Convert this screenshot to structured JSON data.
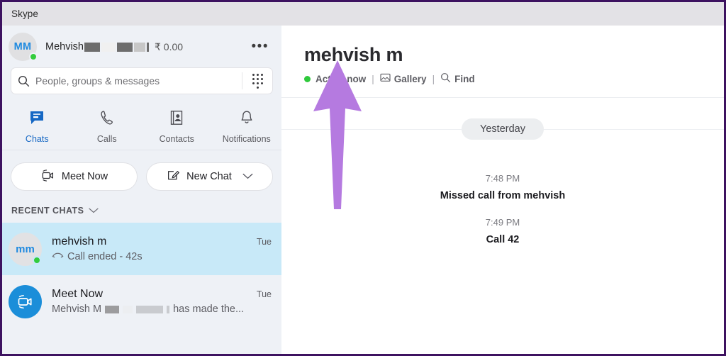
{
  "window": {
    "title": "Skype",
    "border_color": "#3d1260"
  },
  "sidebar": {
    "profile": {
      "avatar_initials": "MM",
      "name": "Mehvish",
      "balance": "₹ 0.00",
      "presence": "online",
      "more_label": "•••"
    },
    "search": {
      "placeholder": "People, groups & messages",
      "value": ""
    },
    "tabs": [
      {
        "label": "Chats",
        "icon": "chat-icon",
        "active": true
      },
      {
        "label": "Calls",
        "icon": "phone-icon",
        "active": false
      },
      {
        "label": "Contacts",
        "icon": "contacts-icon",
        "active": false
      },
      {
        "label": "Notifications",
        "icon": "bell-icon",
        "active": false
      }
    ],
    "actions": {
      "meet_now": "Meet Now",
      "new_chat": "New Chat"
    },
    "recent_chats_label": "RECENT CHATS",
    "chats": [
      {
        "avatar_initials": "mm",
        "name": "mehvish m",
        "time": "Tue",
        "preview": "Call ended - 42s",
        "selected": true,
        "presence": "online"
      },
      {
        "avatar_icon": "video-camera-icon",
        "name": "Meet Now",
        "time": "Tue",
        "preview_prefix": "Mehvish M",
        "preview_suffix": "has made the...",
        "selected": false
      }
    ]
  },
  "main": {
    "conversation_title": "mehvish m",
    "status": "Active now",
    "links": [
      {
        "label": "Gallery",
        "icon": "gallery-icon"
      },
      {
        "label": "Find",
        "icon": "search-icon"
      }
    ],
    "separator": "|",
    "day_divider": "Yesterday",
    "messages": [
      {
        "time": "7:48 PM",
        "event": "Missed call from mehvish"
      },
      {
        "time": "7:49 PM",
        "event": "Call 42"
      }
    ]
  },
  "annotation": {
    "type": "arrow-up",
    "color": "#b57ae0"
  }
}
